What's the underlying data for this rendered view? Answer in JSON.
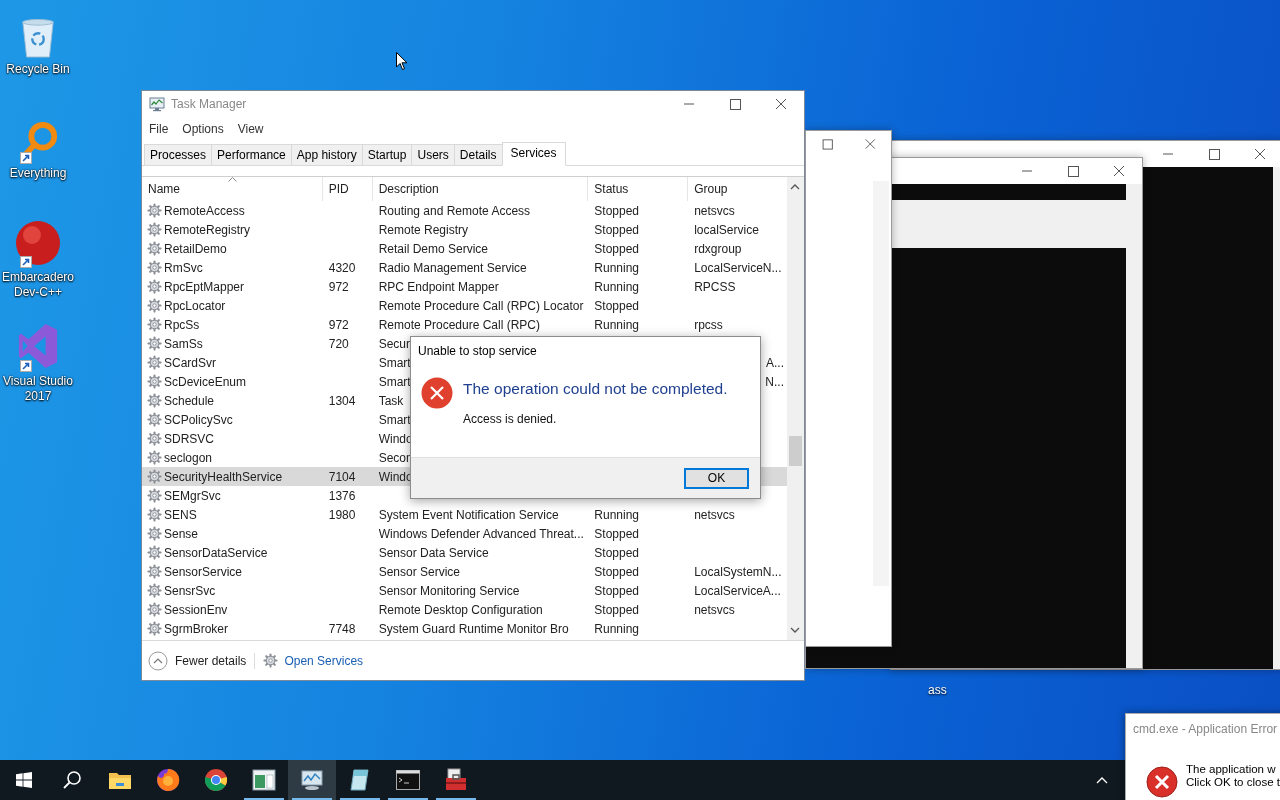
{
  "desktop_icons": [
    {
      "label": "Recycle Bin",
      "kind": "recycle",
      "shortcut": false
    },
    {
      "label": "Everything",
      "kind": "magnifier",
      "shortcut": true
    },
    {
      "label": "Embarcadero Dev-C++",
      "kind": "devcpp",
      "shortcut": true
    },
    {
      "label": "Visual Studio 2017",
      "kind": "vs",
      "shortcut": true
    }
  ],
  "desktop_label": "ass",
  "task_manager": {
    "title": "Task Manager",
    "menu": [
      "File",
      "Options",
      "View"
    ],
    "tabs": [
      {
        "label": "Processes",
        "selected": false
      },
      {
        "label": "Performance",
        "selected": false
      },
      {
        "label": "App history",
        "selected": false
      },
      {
        "label": "Startup",
        "selected": false
      },
      {
        "label": "Users",
        "selected": false
      },
      {
        "label": "Details",
        "selected": false
      },
      {
        "label": "Services",
        "selected": true
      }
    ],
    "columns": [
      {
        "label": "Name",
        "sorted": true
      },
      {
        "label": "PID",
        "sorted": false
      },
      {
        "label": "Description",
        "sorted": false
      },
      {
        "label": "Status",
        "sorted": false
      },
      {
        "label": "Group",
        "sorted": false
      }
    ],
    "rows": [
      {
        "name": "RemoteAccess",
        "description": "Routing and Remote Access",
        "status": "Stopped",
        "group": "netsvcs",
        "selected": false
      },
      {
        "name": "RemoteRegistry",
        "description": "Remote Registry",
        "status": "Stopped",
        "group": "localService",
        "selected": false
      },
      {
        "name": "RetailDemo",
        "description": "Retail Demo Service",
        "status": "Stopped",
        "group": "rdxgroup",
        "selected": false
      },
      {
        "name": "RmSvc",
        "pid": "4320",
        "description": "Radio Management Service",
        "status": "Running",
        "group": "LocalServiceN...",
        "selected": false
      },
      {
        "name": "RpcEptMapper",
        "pid": "972",
        "description": "RPC Endpoint Mapper",
        "status": "Running",
        "group": "RPCSS",
        "selected": false
      },
      {
        "name": "RpcLocator",
        "description": "Remote Procedure Call (RPC) Locator",
        "status": "Stopped",
        "selected": false
      },
      {
        "name": "RpcSs",
        "pid": "972",
        "description": "Remote Procedure Call (RPC)",
        "status": "Running",
        "group": "rpcss",
        "selected": false
      },
      {
        "name": "SamSs",
        "pid": "720",
        "description": "Secur",
        "selected": false
      },
      {
        "name": "SCardSvr",
        "description": "Smart",
        "group_tail": "A...",
        "selected": false
      },
      {
        "name": "ScDeviceEnum",
        "description": "Smart",
        "group_tail": "N...",
        "selected": false
      },
      {
        "name": "Schedule",
        "pid": "1304",
        "description": "Task",
        "selected": false
      },
      {
        "name": "SCPolicySvc",
        "description": "Smart",
        "selected": false
      },
      {
        "name": "SDRSVC",
        "description": "Windo",
        "selected": false
      },
      {
        "name": "seclogon",
        "description": "Secon",
        "selected": false
      },
      {
        "name": "SecurityHealthService",
        "pid": "7104",
        "description": "Windo",
        "selected": true
      },
      {
        "name": "SEMgrSvc",
        "pid": "1376",
        "selected": false
      },
      {
        "name": "SENS",
        "pid": "1980",
        "description": "System Event Notification Service",
        "status": "Running",
        "group": "netsvcs",
        "selected": false
      },
      {
        "name": "Sense",
        "description": "Windows Defender Advanced Threat...",
        "status": "Stopped",
        "selected": false
      },
      {
        "name": "SensorDataService",
        "description": "Sensor Data Service",
        "status": "Stopped",
        "selected": false
      },
      {
        "name": "SensorService",
        "description": "Sensor Service",
        "status": "Stopped",
        "group": "LocalSystemN...",
        "selected": false
      },
      {
        "name": "SensrSvc",
        "description": "Sensor Monitoring Service",
        "status": "Stopped",
        "group": "LocalServiceA...",
        "selected": false
      },
      {
        "name": "SessionEnv",
        "description": "Remote Desktop Configuration",
        "status": "Stopped",
        "group": "netsvcs",
        "selected": false
      },
      {
        "name": "SgrmBroker",
        "pid": "7748",
        "description": "System Guard Runtime Monitor Bro",
        "status": "Running",
        "selected": false
      }
    ],
    "fewer_details": "Fewer details",
    "open_services": "Open Services"
  },
  "dialog": {
    "title": "Unable to stop service",
    "heading": "The operation could not be completed.",
    "message": "Access is denied.",
    "button": "OK"
  },
  "error_dialog": {
    "title": "cmd.exe - Application Error",
    "lines": [
      "The application w",
      "Click OK to close t"
    ]
  },
  "taskbar": {
    "apps": [
      {
        "kind": "explorer",
        "running": false,
        "active": false
      },
      {
        "kind": "firefox",
        "running": false,
        "active": false
      },
      {
        "kind": "chrome",
        "running": false,
        "active": false
      },
      {
        "kind": "app",
        "running": true,
        "active": false
      },
      {
        "kind": "taskmgr",
        "running": true,
        "active": true
      },
      {
        "kind": "notepad",
        "running": true,
        "active": false
      },
      {
        "kind": "cmd",
        "running": true,
        "active": false
      },
      {
        "kind": "toolbox",
        "running": true,
        "active": false
      }
    ]
  }
}
